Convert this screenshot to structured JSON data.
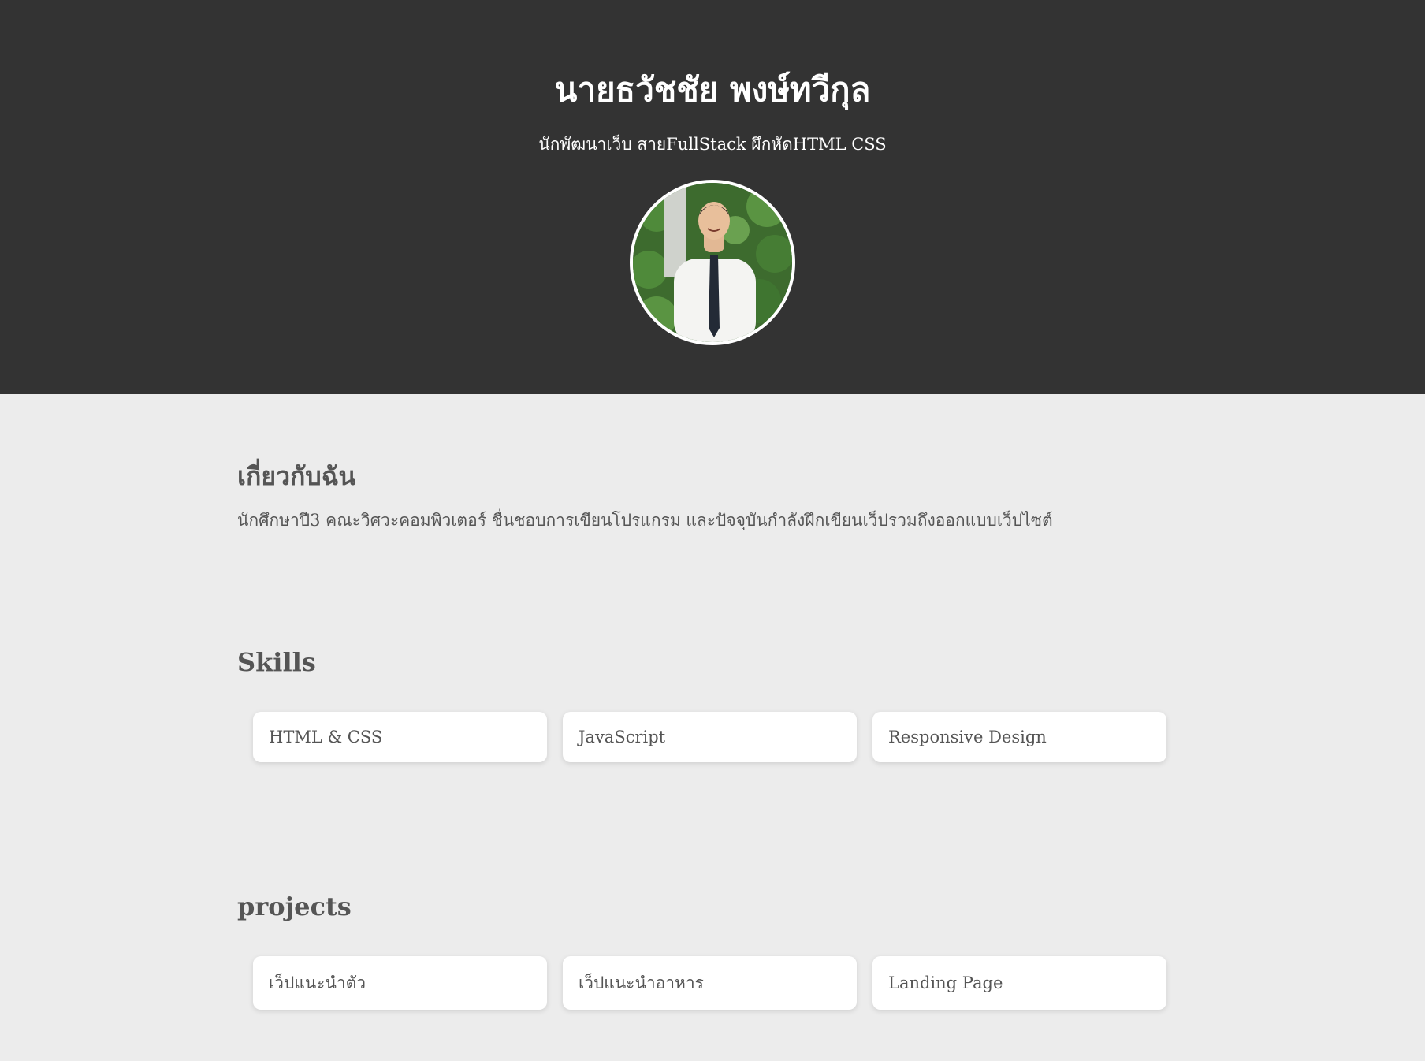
{
  "header": {
    "name": "นายธวัชชัย พงษ์ทวีกุล",
    "tagline": "นักพัฒนาเว็บ สายFullStack ผึกหัดHTML CSS",
    "avatar_icon": "profile-photo"
  },
  "about": {
    "heading": "เกี่ยวกับฉัน",
    "text": "นักศึกษาปี3 คณะวิศวะคอมพิวเตอร์ ชื่นชอบการเขียนโปรแกรม และปัจจุบันกำลังฝึกเขียนเว็ปรวมถึงออกแบบเว็ปไซต์"
  },
  "skills": {
    "heading": "Skills",
    "items": [
      "HTML & CSS",
      "JavaScript",
      "Responsive Design"
    ]
  },
  "projects": {
    "heading": "projects",
    "items": [
      "เว็ปแนะนำตัว",
      "เว็ปแนะนำอาหาร",
      "Landing Page"
    ]
  },
  "colors": {
    "header_bg": "#333333",
    "page_bg": "#ececec",
    "text": "#555555",
    "card_bg": "#ffffff"
  }
}
